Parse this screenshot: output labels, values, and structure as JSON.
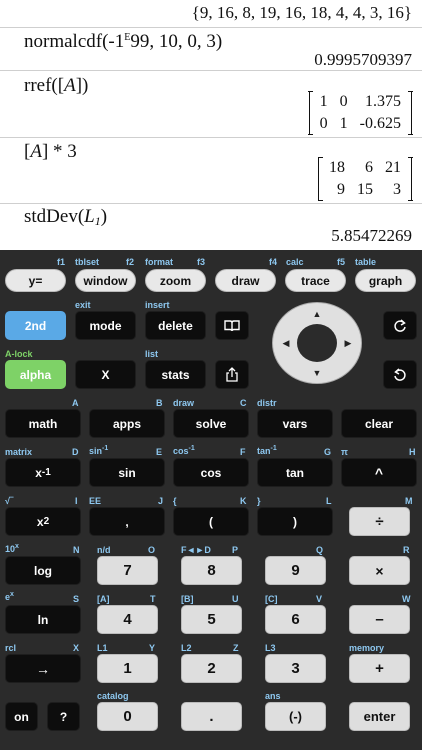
{
  "history": [
    {
      "result": "{9, 16, 8, 19, 16, 18, 4, 4, 3, 16}"
    },
    {
      "expr": "normalcdf(-1",
      "expr_e": "E",
      "expr_rest": "99, 10, 0, 3)",
      "result": "0.9995709397"
    },
    {
      "expr": "rref([",
      "expr_var": "A",
      "expr_rest": "])",
      "matrix": [
        [
          "1",
          "0",
          "1.375"
        ],
        [
          "0",
          "1",
          "-0.625"
        ]
      ]
    },
    {
      "expr": "[",
      "expr_var": "A",
      "expr_rest": "] * 3",
      "matrix": [
        [
          "18",
          "6",
          "21"
        ],
        [
          "9",
          "15",
          "3"
        ]
      ]
    },
    {
      "expr": "stdDev(",
      "expr_var": "L",
      "expr_sub": "1",
      "expr_rest": ")",
      "result": "5.85472269"
    }
  ],
  "keys": {
    "y_eq": "y=",
    "window": "window",
    "zoom": "zoom",
    "draw": "draw",
    "trace": "trace",
    "graph": "graph",
    "second": "2nd",
    "mode": "mode",
    "delete": "delete",
    "alpha": "alpha",
    "x": "X",
    "stats": "stats",
    "math": "math",
    "apps": "apps",
    "solve": "solve",
    "vars": "vars",
    "clear": "clear",
    "x_inv": "x",
    "x_inv_sup": "-1",
    "sin": "sin",
    "cos": "cos",
    "tan": "tan",
    "caret": "^",
    "x_sq": "x",
    "x_sq_sup": "2",
    "comma": ",",
    "lparen": "(",
    "rparen": ")",
    "divide": "÷",
    "log": "log",
    "seven": "7",
    "eight": "8",
    "nine": "9",
    "times": "×",
    "ln": "ln",
    "four": "4",
    "five": "5",
    "six": "6",
    "minus": "–",
    "sto": "→",
    "one": "1",
    "two": "2",
    "three": "3",
    "plus": "+",
    "on": "on",
    "help": "?",
    "zero": "0",
    "decimal": ".",
    "negate": "(-)",
    "enter": "enter"
  },
  "labels": {
    "f1": "f1",
    "tblset": "tblset",
    "f2": "f2",
    "format": "format",
    "f3": "f3",
    "f4": "f4",
    "calc": "calc",
    "f5": "f5",
    "table": "table",
    "exit": "exit",
    "insert": "insert",
    "alock": "A-lock",
    "list": "list",
    "a": "A",
    "b": "B",
    "draw": "draw",
    "c": "C",
    "distr": "distr",
    "matrix": "matrix",
    "d": "D",
    "sin_inv": "sin",
    "e": "E",
    "cos_inv": "cos",
    "f": "F",
    "tan_inv": "tan",
    "g": "G",
    "pi": "π",
    "h": "H",
    "sqrt": "√‾",
    "i": "I",
    "ee": "EE",
    "j": "J",
    "lbrace": "{",
    "k": "K",
    "rbrace": "}",
    "l": "L",
    "m": "M",
    "ten_x": "10",
    "ten_x_sup": "x",
    "n": "N",
    "nd": "n/d",
    "o": "O",
    "frac": "F◄►D",
    "p": "P",
    "q": "Q",
    "r": "R",
    "e_x": "e",
    "e_x_sup": "x",
    "s": "S",
    "ma": "[A]",
    "t": "T",
    "mb": "[B]",
    "u": "U",
    "mc": "[C]",
    "v": "V",
    "w": "W",
    "rcl": "rcl",
    "x": "X",
    "l1": "L1",
    "y": "Y",
    "l2": "L2",
    "z": "Z",
    "l3": "L3",
    "memory": "memory",
    "catalog": "catalog",
    "ans": "ans",
    "inv_sup": "-1"
  },
  "icons": {
    "book": "book-icon",
    "redo": "redo-icon",
    "undo": "undo-icon",
    "share": "share-icon"
  },
  "colors": {
    "blue_key": "#5aa9e6",
    "green_key": "#7ed267",
    "label_blue": "#8ec8f0"
  }
}
